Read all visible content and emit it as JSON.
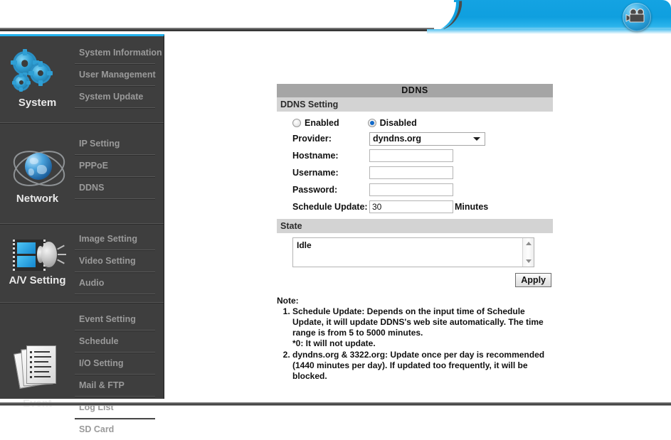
{
  "header": {
    "brand_icon": "movie-camera-icon",
    "accent_color": "#0f9fdf"
  },
  "sidebar": {
    "groups": [
      {
        "id": "system",
        "label": "System",
        "icon": "gears-icon",
        "items": [
          {
            "label": "System Information"
          },
          {
            "label": "User Management"
          },
          {
            "label": "System Update"
          }
        ]
      },
      {
        "id": "network",
        "label": "Network",
        "icon": "globe-icon",
        "items": [
          {
            "label": "IP Setting"
          },
          {
            "label": "PPPoE"
          },
          {
            "label": "DDNS"
          }
        ]
      },
      {
        "id": "av-setting",
        "label": "A/V Setting",
        "icon": "film-speaker-icon",
        "items": [
          {
            "label": "Image Setting"
          },
          {
            "label": "Video Setting"
          },
          {
            "label": "Audio"
          }
        ]
      },
      {
        "id": "event",
        "label": "Event",
        "icon": "documents-icon",
        "items": [
          {
            "label": "Event Setting"
          },
          {
            "label": "Schedule"
          },
          {
            "label": "I/O Setting"
          },
          {
            "label": "Mail & FTP"
          },
          {
            "label": "Log List"
          },
          {
            "label": "SD Card"
          }
        ]
      }
    ]
  },
  "main": {
    "panel_title": "DDNS",
    "setting_section_label": "DDNS Setting",
    "state_section_label": "State",
    "radio": {
      "enabled_label": "Enabled",
      "disabled_label": "Disabled",
      "selected": "Disabled"
    },
    "fields": {
      "provider_label": "Provider:",
      "provider_value": "dyndns.org",
      "hostname_label": "Hostname:",
      "hostname_value": "",
      "username_label": "Username:",
      "username_value": "",
      "password_label": "Password:",
      "password_value": "",
      "schedule_label": "Schedule Update:",
      "schedule_value": "30",
      "schedule_unit": "Minutes"
    },
    "state_text": "Idle",
    "apply_label": "Apply",
    "note": {
      "heading": "Note:",
      "item1": "Schedule Update: Depends on the input time of Schedule Update, it will update DDNS's web site automatically. The time range is from 5 to 5000 minutes.",
      "item1_sub": "*0: It will not update.",
      "item2": "dyndns.org & 3322.org: Update once per day is recommended (1440 minutes per day). If updated too frequently, it will be blocked."
    }
  }
}
